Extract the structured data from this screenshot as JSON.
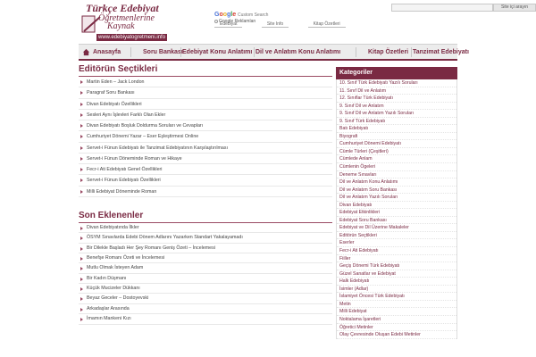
{
  "header": {
    "logo": {
      "line1": "Türkçe Edebiyat",
      "line2": "Öğretmenlerine",
      "line3": "Kaynak",
      "url": "www.edebiyatogretmeni.info"
    },
    "site_search": {
      "placeholder": "",
      "button_label": "Site içi arayın"
    },
    "google_search": {
      "logo_text": "Google",
      "label": "Custom Search",
      "ads_label": "Google Reklamları"
    },
    "quick_links": [
      "Edebiyat",
      "Site Info",
      "Kitap Özetleri"
    ]
  },
  "nav": {
    "items": [
      "Anasayfa",
      "Soru Bankası",
      "Edebiyat Konu Anlatımı",
      "Dil ve Anlatım Konu Anlatımı",
      "Kitap Özetleri",
      "Tanzimat Edebiyatı"
    ]
  },
  "editor": {
    "title": "Editörün Seçtikleri",
    "items": [
      "Martin Eden – Jack London",
      "Paragraf Soru Bankası",
      "Divan Edebiyatı Özellikleri",
      "Sesleri Aynı İşlevleri Farklı Olan Ekler",
      "Divan Edebiyatı Boşluk Doldurma Soruları ve Cevapları",
      "Cumhuriyet Dönemi Yazar – Eser Eşleştirmesi Online",
      "Servet-i Fünun Edebiyatı ile Tanzimat Edebiyatının Karşılaştırılması",
      "Servet-i Fünun Döneminde Roman ve Hikaye",
      "Fecr-i Ati Edebiyatı Genel Özellikleri",
      "Servet-i Fünun Edebiyatı Özellikleri",
      "Milli Edebiyat Döneminde Roman"
    ]
  },
  "recent": {
    "title": "Son Eklenenler",
    "items": [
      "Divan Edebiyatında İlkler",
      "ÖSYM Sınavlarda Edebi Dönem Adlarını Yazarken Standart Yakalayamadı",
      "Bir Dilekle Başladı Her Şey Romanı Geniş Özeti – İncelemesi",
      "Benefşe Romanı Özeti ve İncelemesi",
      "Mutlu Olmak İsteyen Adam",
      "Bir Kadın Düşmanı",
      "Küçük Mucizeler Dükkanı",
      "Beyaz Geceler – Dostoyevski",
      "Arkadaşlar Arasında",
      "İmamın Mankeni Kızı"
    ]
  },
  "sidebar": {
    "title": "Kategoriler",
    "items": [
      "10. Sınıf Türk Edebiyatı Yazılı Soruları",
      "11. Sınıf Dil ve Anlatım",
      "12. Sınıflar Türk Edebiyatı",
      "9. Sınıf Dil ve Anlatım",
      "9. Sınıf Dil ve Anlatım Yazılı Soruları",
      "9. Sınıf Türk Edebiyatı",
      "Batı Edebiyatı",
      "Biyografi",
      "Cumhuriyet Dönemi Edebiyatı",
      "Cümle Türleri (Çeşitleri)",
      "Cümlede Anlam",
      "Cümlenin Ögeleri",
      "Deneme Sınavları",
      "Dil ve Anlatım Konu Anlatımı",
      "Dil ve Anlatım Soru Bankası",
      "Dil ve Anlatım Yazılı Soruları",
      "Divan Edebiyatı",
      "Edebiyat Etkinlikleri",
      "Edebiyat Soru Bankası",
      "Edebiyat ve Dil Üzerine Makaleler",
      "Editörün Seçtikleri",
      "Eserler",
      "Fecr-i Ati Edebiyatı",
      "Fiiller",
      "Geçiş Dönemi Türk Edebiyatı",
      "Güzel Sanatlar ve Edebiyat",
      "Halk Edebiyatı",
      "İsimler (Adlar)",
      "İslamiyet Öncesi Türk Edebiyatı",
      "Metin",
      "Milli Edebiyat",
      "Noktalama İşaretleri",
      "Öğretici Metinler",
      "Olay Çevresinde Oluşan Edebi Metinler"
    ]
  },
  "colors": {
    "accent": "#7a2a43",
    "nav_bg": "#ececec"
  }
}
